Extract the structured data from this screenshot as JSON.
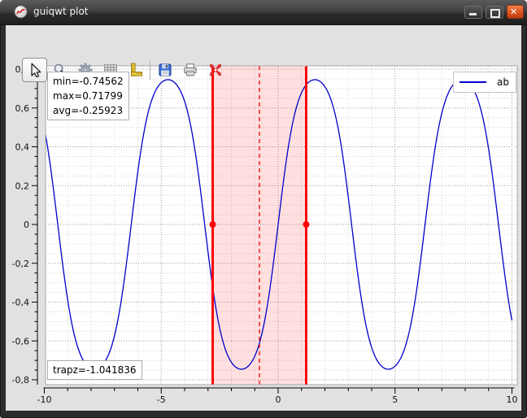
{
  "window": {
    "title": "guiqwt plot",
    "logo_icon": "guiqwt-logo-icon",
    "controls": [
      {
        "name": "minimize",
        "icon": "minimize-icon"
      },
      {
        "name": "maximize",
        "icon": "maximize-icon"
      },
      {
        "name": "close",
        "icon": "close-icon",
        "color": "#d9531f"
      }
    ]
  },
  "toolbar": {
    "items": [
      {
        "name": "select-tool",
        "icon": "cursor-arrow-icon",
        "active": true
      },
      {
        "name": "zoom-tool",
        "icon": "magnifier-icon",
        "active": false
      },
      {
        "name": "item-parameters",
        "icon": "gear-icon",
        "active": false
      },
      {
        "name": "grid-parameters",
        "icon": "grid-icon",
        "active": false
      },
      {
        "name": "axes-scales",
        "icon": "ruler-icon",
        "active": false
      },
      {
        "name": "separator-1",
        "separator": true
      },
      {
        "name": "save",
        "icon": "floppy-disk-icon",
        "active": false
      },
      {
        "name": "print",
        "icon": "printer-icon",
        "active": false
      },
      {
        "name": "auto-fit",
        "icon": "red-move-arrows-icon",
        "active": false
      }
    ]
  },
  "plot": {
    "stats_box": {
      "lines": [
        "min=-0.74562",
        "max=0.71799",
        "avg=-0.25923"
      ]
    },
    "trapz_box": {
      "text": "trapz=-1.041836"
    },
    "legend": {
      "label": "ab"
    }
  },
  "chart_data": {
    "type": "line",
    "title": "",
    "xlabel": "",
    "ylabel": "",
    "series": [
      {
        "name": "ab",
        "color": "#0000cc",
        "formula": "Math.sin(Math.sin(Math.sin(x)))",
        "x_range": [
          -10,
          10
        ],
        "n_points": 600
      }
    ],
    "xlim": [
      -10,
      10
    ],
    "ylim": [
      -0.8,
      0.8
    ],
    "x_ticks": {
      "major": [
        {
          "v": -10,
          "label": "-10"
        },
        {
          "v": -5,
          "label": "-5"
        },
        {
          "v": 0,
          "label": "0"
        },
        {
          "v": 5,
          "label": "5"
        },
        {
          "v": 10,
          "label": "10"
        }
      ],
      "minor_step": 1
    },
    "y_ticks": {
      "major": [
        {
          "v": 0.8,
          "label": "0,8"
        },
        {
          "v": 0.6,
          "label": "0,6"
        },
        {
          "v": 0.4,
          "label": "0,4"
        },
        {
          "v": 0.2,
          "label": "0,2"
        },
        {
          "v": 0,
          "label": "0"
        },
        {
          "v": -0.2,
          "label": "-0,2"
        },
        {
          "v": -0.4,
          "label": "-0,4"
        },
        {
          "v": -0.6,
          "label": "-0,6"
        },
        {
          "v": -0.8,
          "label": "-0,8"
        }
      ],
      "minor_step": 0.05
    },
    "grid": {
      "on": true,
      "style": "dotted",
      "major_color": "#9c9c9c",
      "minor_color": "#d6d6d6"
    },
    "range_selection": {
      "start": -2.8,
      "end": 1.2,
      "center": -0.8,
      "marker_y": 0,
      "line_color": "#ff0000",
      "fill_color": "rgba(255,0,0,0.12)"
    },
    "legend_position": "TR",
    "annotations": [
      {
        "position": "TL",
        "text": [
          "min=-0.74562",
          "max=0.71799",
          "avg=-0.25923"
        ]
      },
      {
        "position": "BL",
        "text": [
          "trapz=-1.041836"
        ]
      }
    ]
  }
}
